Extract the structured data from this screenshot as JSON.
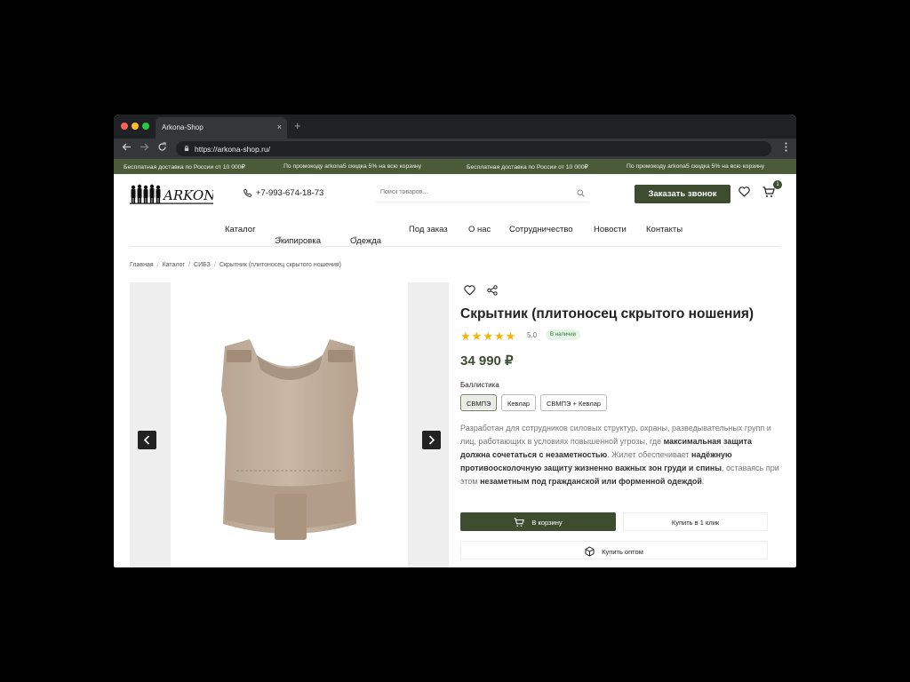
{
  "browser": {
    "tab_title": "Arkona-Shop",
    "tab_close": "×",
    "new_tab": "+",
    "url": "https://arkona-shop.ru/"
  },
  "promo": {
    "items": [
      "Бесплатная доставка по России от 10 000₽",
      "По промокоду arkona5 скидка 5% на всю корзину",
      "Бесплатная доставка по России от 10 000₽",
      "По промокоду arkona5 скидка 5% на всю корзину"
    ]
  },
  "header": {
    "logo_text": "ARKONA",
    "phone": "+7-993-674-18-73",
    "search_placeholder": "Поиск товаров...",
    "call_button": "Заказать звонок",
    "cart_count": "1"
  },
  "menu": {
    "items": [
      "Каталог",
      "Экипировка",
      "Одежда",
      "Под заказ",
      "О нас",
      "Сотрудничество",
      "Новости",
      "Контакты"
    ]
  },
  "breadcrumb": {
    "items": [
      "Главная",
      "Каталог",
      "СИБЗ",
      "Скрытник (плитоносец скрытого ношения)"
    ],
    "separator": "/"
  },
  "product": {
    "title": "Скрытник (плитоносец скрытого ношения)",
    "rating": "5.0",
    "rating_stars": 5,
    "availability": "В наличии",
    "price": "34 990 ₽",
    "option_label": "Баллистика",
    "options": [
      "СВМПЭ",
      "Кевлар",
      "СВМПЭ + Кевлар"
    ],
    "selected_option": "СВМПЭ",
    "description": {
      "p1": "Разработан для сотрудников силовых структур, охраны, разведывательных групп и лиц, работающих в условиях повышенной угрозы, где ",
      "b1": "максимальная защита должна сочетаться с незаметностью",
      "p2": ". Жилет обеспечивает ",
      "b2": "надёжную противоосколочную защиту жизненно важных зон груди и спины",
      "p3": ", оставаясь при этом ",
      "b3": "незаметным под гражданской или форменной одеждой",
      "p4": "."
    },
    "add_to_cart": "В корзину",
    "buy_one_click": "Купить в 1 клик",
    "buy_wholesale": "Купить оптом"
  },
  "colors": {
    "brand_green": "#3e4d30",
    "promo_bar": "#4b5b3a",
    "star": "#f5b301"
  }
}
